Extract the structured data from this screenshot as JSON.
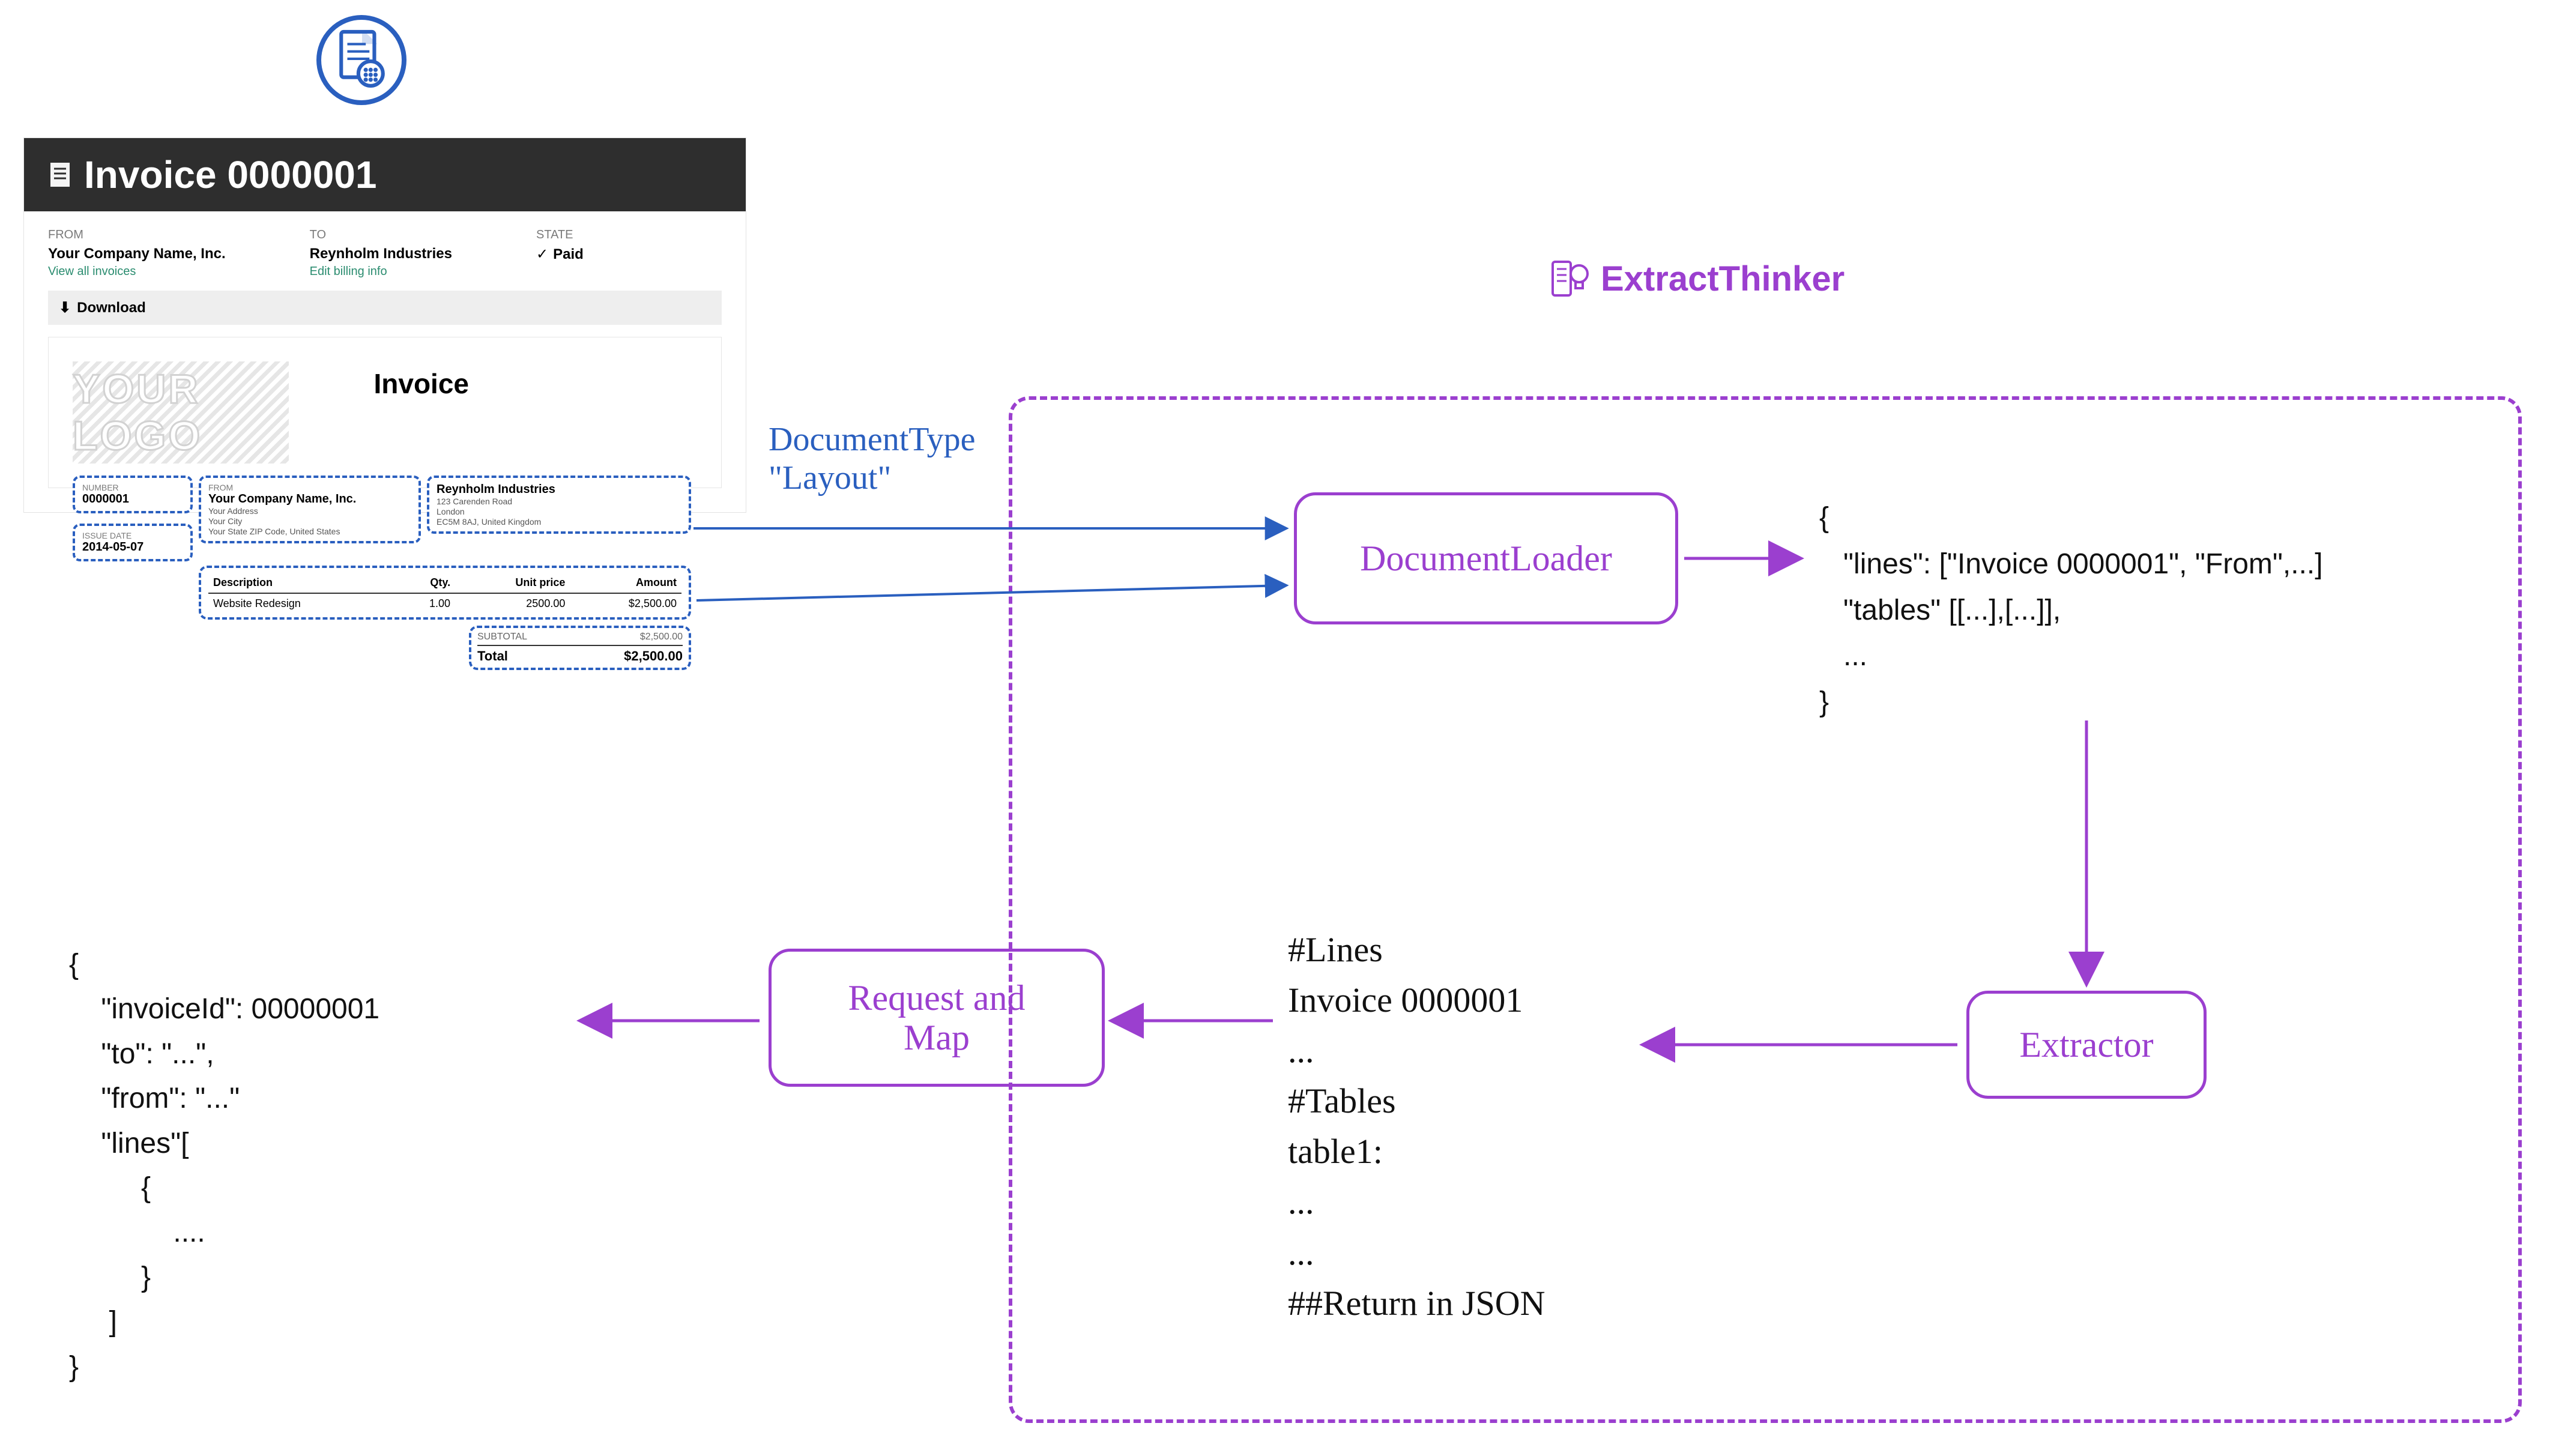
{
  "brand": {
    "name": "ExtractThinker"
  },
  "invoice": {
    "title": "Invoice 0000001",
    "from_label": "FROM",
    "from_company": "Your Company Name, Inc.",
    "from_link": "View all invoices",
    "to_label": "TO",
    "to_company": "Reynholm Industries",
    "to_link": "Edit billing info",
    "state_label": "STATE",
    "state_value": "Paid",
    "download": "Download",
    "logo_text": "YOUR LOGO",
    "heading": "Invoice",
    "chips": {
      "number_label": "NUMBER",
      "number": "0000001",
      "issue_label": "ISSUE DATE",
      "issue": "2014-05-07",
      "from2_label": "FROM",
      "from2_name": "Your Company Name, Inc.",
      "from2_addr": "Your Address\nYour City\nYour State ZIP Code, United States",
      "to2_name": "Reynholm Industries",
      "to2_addr": "123 Carenden Road\nLondon\nEC5M 8AJ, United Kingdom"
    },
    "table": {
      "headers": {
        "desc": "Description",
        "qty": "Qty.",
        "unit": "Unit price",
        "amount": "Amount"
      },
      "rows": [
        {
          "desc": "Website Redesign",
          "qty": "1.00",
          "unit": "2500.00",
          "amount": "$2,500.00"
        }
      ],
      "subtotal_label": "SUBTOTAL",
      "subtotal": "$2,500.00",
      "total_label": "Total",
      "total": "$2,500.00"
    }
  },
  "labels": {
    "doctype_l1": "DocumentType",
    "doctype_l2": "\"Layout\"",
    "loader": "DocumentLoader",
    "extractor": "Extractor",
    "request_l1": "Request and",
    "request_l2": "Map"
  },
  "loader_output": "{\n   \"lines\": [\"Invoice 0000001\", \"From\",...]\n   \"tables\" [[...],[...]],\n   ...\n}",
  "prompt": "#Lines\nInvoice 0000001\n...\n#Tables\ntable1:\n...\n...\n##Return in JSON",
  "final_json": "{\n    \"invoiceId\": 00000001\n    \"to\": \"...\",\n    \"from\": \"...\"\n    \"lines\"[\n         {\n             ....\n         }\n     ]\n}"
}
